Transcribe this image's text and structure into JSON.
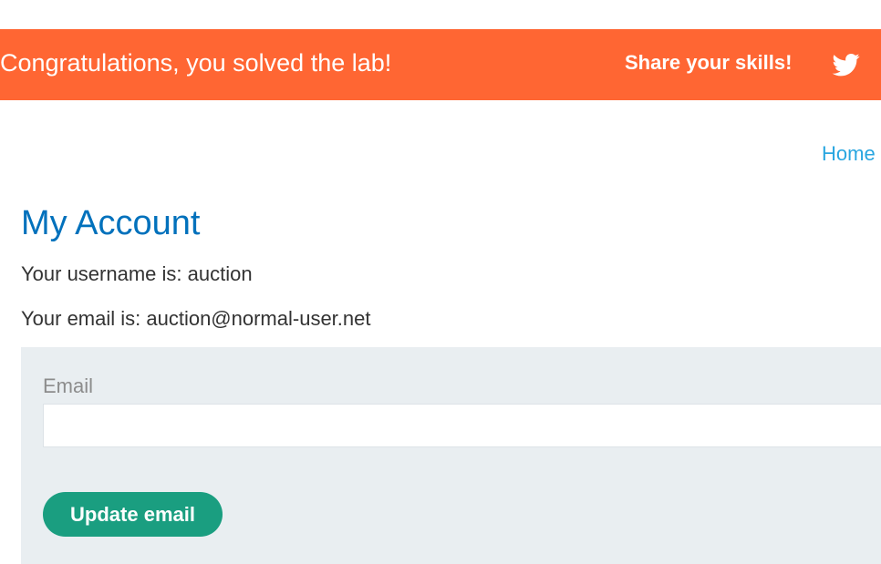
{
  "banner": {
    "message": "Congratulations, you solved the lab!",
    "share_label": "Share your skills!",
    "share_icon": "twitter-icon",
    "background_color": "#ff6633"
  },
  "nav": {
    "home_label": "Home"
  },
  "account": {
    "title": "My Account",
    "username_line": "Your username is: auction",
    "email_line": "Your email is: auction@normal-user.net"
  },
  "form": {
    "email_label": "Email",
    "email_value": "",
    "submit_label": "Update email",
    "button_color": "#1a9e80"
  }
}
